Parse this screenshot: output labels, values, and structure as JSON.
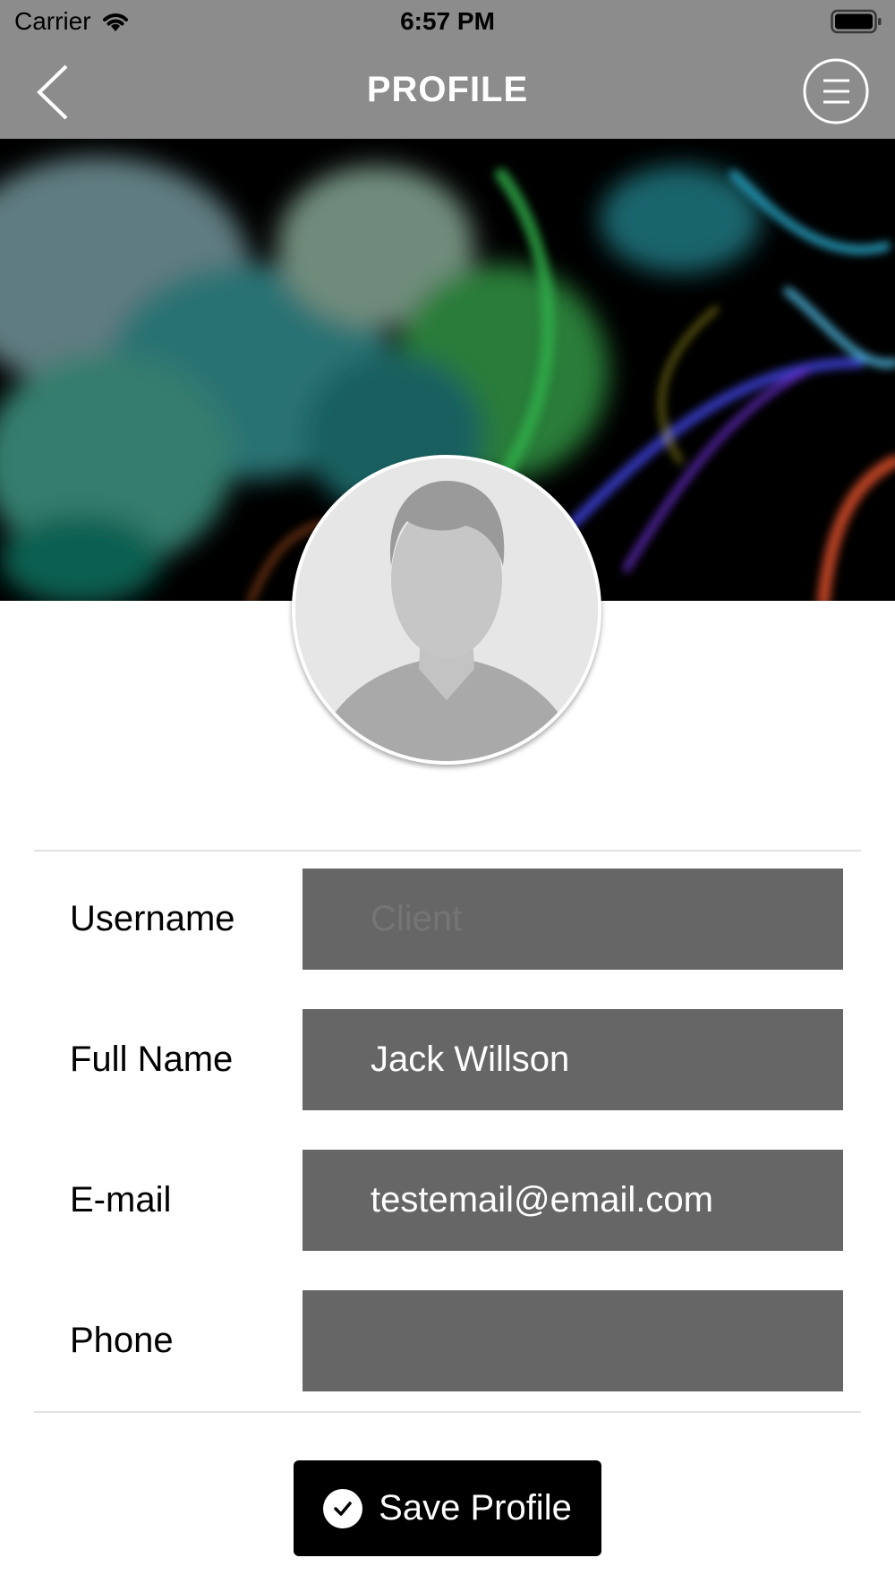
{
  "status_bar": {
    "carrier": "Carrier",
    "time": "6:57 PM"
  },
  "nav": {
    "title": "PROFILE",
    "back_icon": "chevron-left-icon",
    "menu_icon": "hamburger-menu-icon"
  },
  "cover_image": "colorful-smoke-background",
  "avatar": "default-user-avatar",
  "form": {
    "fields": [
      {
        "label": "Username",
        "value": "",
        "placeholder": "Client"
      },
      {
        "label": "Full Name",
        "value": "Jack Willson",
        "placeholder": ""
      },
      {
        "label": "E-mail",
        "value": "testemail@email.com",
        "placeholder": ""
      },
      {
        "label": "Phone",
        "value": "",
        "placeholder": ""
      }
    ]
  },
  "save_button": {
    "label": "Save Profile",
    "icon": "checkmark-icon"
  },
  "colors": {
    "nav_bg": "#8c8c8c",
    "field_bg": "#666666",
    "button_bg": "#000000"
  }
}
